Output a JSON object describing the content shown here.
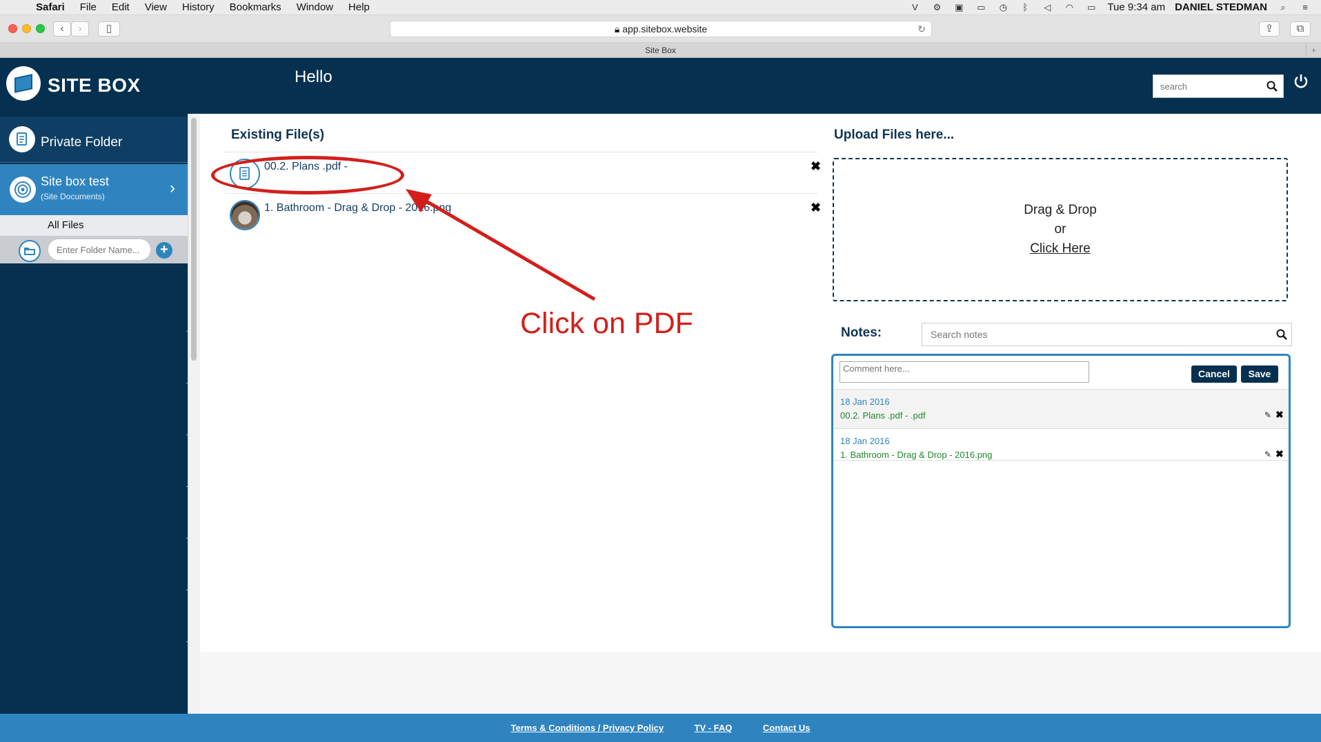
{
  "os_menu": {
    "app": "Safari",
    "items": [
      "File",
      "Edit",
      "View",
      "History",
      "Bookmarks",
      "Window",
      "Help"
    ],
    "clock": "Tue 9:34 am",
    "user": "DANIEL STEDMAN"
  },
  "browser": {
    "url": "app.sitebox.website",
    "tab_title": "Site Box"
  },
  "header": {
    "brand": "SITE BOX",
    "greeting": "Hello",
    "search_placeholder": "search"
  },
  "sidebar": {
    "private_folder": "Private Folder",
    "site_name": "Site box test",
    "site_sub": "(Site Documents)",
    "all_files": "All Files",
    "folder_placeholder": "Enter Folder Name..."
  },
  "files": {
    "title": "Existing File(s)",
    "items": [
      {
        "name": "00.2. Plans .pdf -",
        "type": "pdf"
      },
      {
        "name": "1. Bathroom - Drag & Drop - 2016.png",
        "type": "image"
      }
    ]
  },
  "annotation": {
    "text": "Click on PDF",
    "color": "#d21f1b"
  },
  "upload": {
    "title": "Upload Files here...",
    "line1": "Drag & Drop",
    "line2": "or",
    "link": "Click Here"
  },
  "notes": {
    "label": "Notes:",
    "search_placeholder": "Search notes",
    "comment_placeholder": "Comment here...",
    "cancel": "Cancel",
    "save": "Save",
    "items": [
      {
        "date": "18 Jan 2016",
        "text": "00.2. Plans .pdf - .pdf"
      },
      {
        "date": "18 Jan 2016",
        "text": "1. Bathroom - Drag & Drop - 2016.png"
      }
    ]
  },
  "footer": {
    "links": [
      "Terms & Conditions / Privacy Policy",
      "TV - FAQ",
      "Contact Us"
    ]
  },
  "colors": {
    "header_bg": "#05304f",
    "accent": "#2f84c0",
    "note_text": "#1d8a2a"
  }
}
